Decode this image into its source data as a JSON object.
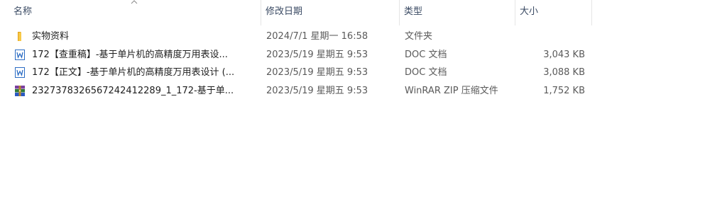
{
  "columns": {
    "name": "名称",
    "date": "修改日期",
    "type": "类型",
    "size": "大小"
  },
  "files": [
    {
      "name": "实物资料",
      "date": "2024/7/1 星期一 16:58",
      "type": "文件夹",
      "size": "",
      "icon": "folder-icon"
    },
    {
      "name": "172【查重稿】-基于单片机的高精度万用表设...",
      "date": "2023/5/19 星期五 9:53",
      "type": "DOC 文档",
      "size": "3,043 KB",
      "icon": "word-doc-icon"
    },
    {
      "name": "172【正文】-基于单片机的高精度万用表设计 (...",
      "date": "2023/5/19 星期五 9:53",
      "type": "DOC 文档",
      "size": "3,088 KB",
      "icon": "word-doc-icon"
    },
    {
      "name": "2327378326567242412289_1_172-基于单...",
      "date": "2023/5/19 星期五 9:53",
      "type": "WinRAR ZIP 压缩文件",
      "size": "1,752 KB",
      "icon": "winrar-archive-icon"
    }
  ]
}
